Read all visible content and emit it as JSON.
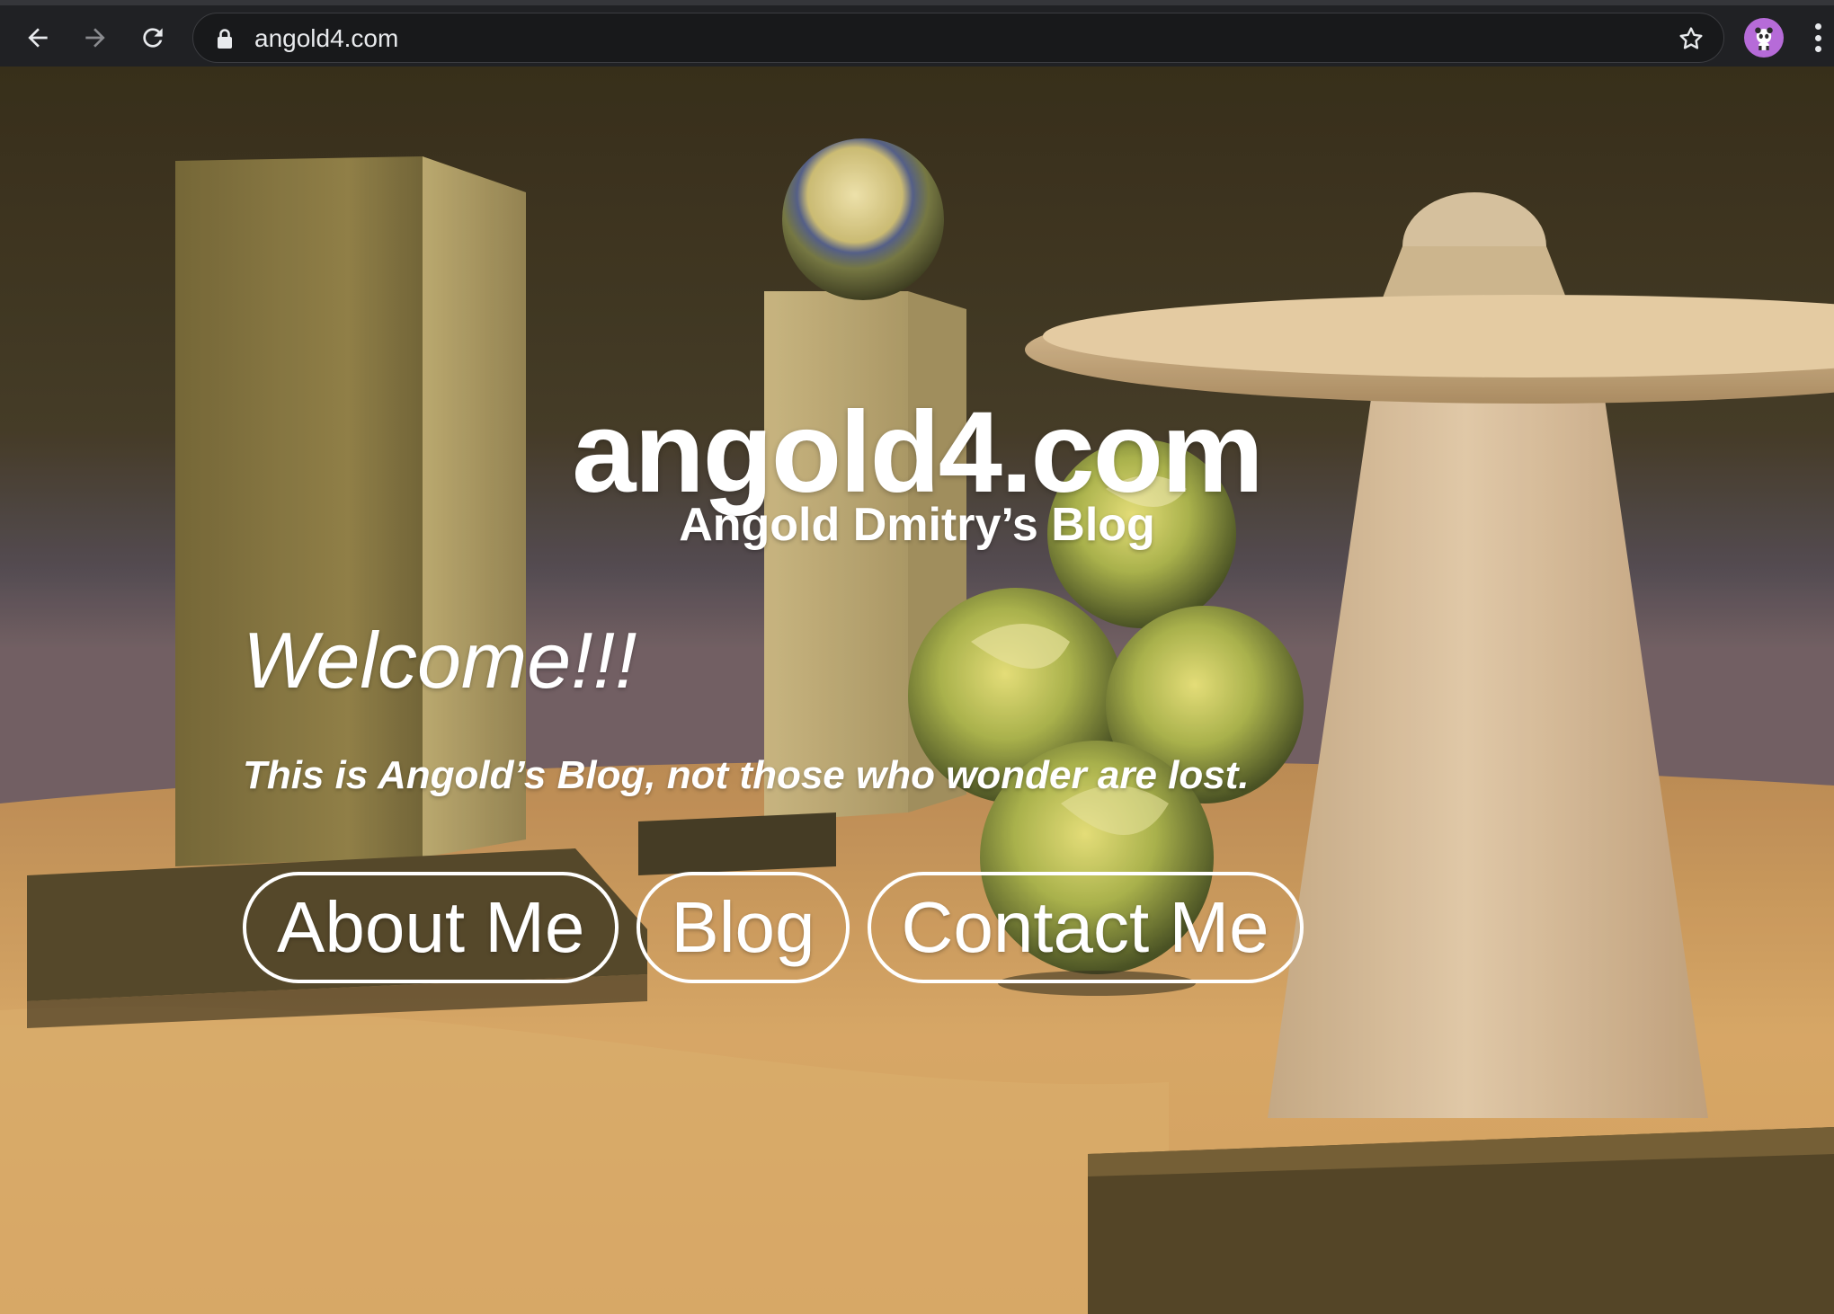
{
  "browser": {
    "url": "angold4.com",
    "icons": {
      "back": "arrow-left-icon",
      "forward": "arrow-right-icon",
      "reload": "reload-icon",
      "lock": "lock-icon",
      "bookmark": "star-icon",
      "profile": "avatar",
      "menu": "kebab-menu-icon"
    },
    "colors": {
      "chrome": "#202124",
      "omnibox": "#18191b",
      "avatar": "#b66bd8"
    }
  },
  "page": {
    "title": "angold4.com",
    "subtitle": "Angold Dmitry’s Blog",
    "welcome": "Welcome!!!",
    "tagline": "This is Angold’s Blog, not those who wonder are lost.",
    "nav": [
      {
        "label": "About Me"
      },
      {
        "label": "Blog"
      },
      {
        "label": "Contact Me"
      }
    ],
    "colors": {
      "text": "#ffffff",
      "background_floor": "#c9a468"
    }
  }
}
